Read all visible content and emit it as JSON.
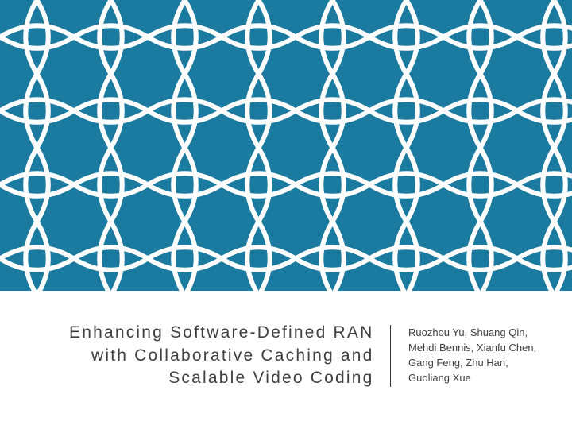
{
  "slide": {
    "title": "Enhancing Software-Defined RAN with Collaborative Caching and Scalable Video Coding",
    "authors": "Ruozhou Yu, Shuang Qin, Mehdi Bennis, Xianfu Chen, Gang Feng, Zhu Han, Guoliang Xue",
    "background_color": "#1b7aa0",
    "pattern_stroke": "#ffffff"
  }
}
